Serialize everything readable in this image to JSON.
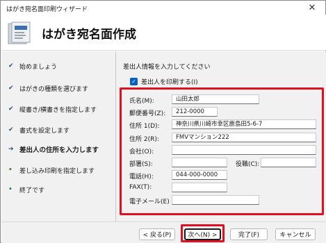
{
  "window": {
    "title": "はがき宛名面印刷ウィザード"
  },
  "header": {
    "heading": "はがき宛名面作成"
  },
  "steps": [
    {
      "mark": "✔",
      "label": "始めましょう"
    },
    {
      "mark": "✔",
      "label": "はがきの種類を選びます"
    },
    {
      "mark": "✔",
      "label": "縦書き/横書きを指定します"
    },
    {
      "mark": "✔",
      "label": "書式を設定します"
    },
    {
      "mark": "➔",
      "label": "差出人の住所を入力します"
    },
    {
      "mark": "•",
      "label": "差し込み印刷を指定します"
    },
    {
      "mark": "•",
      "label": "終了です"
    }
  ],
  "panel": {
    "instruction": "差出人情報を入力してください",
    "print_sender_label": "差出人を印刷する(I)",
    "fields": {
      "name": {
        "label": "氏名(M):",
        "value": "山田太郎"
      },
      "postal": {
        "label": "郵便番号(Z):",
        "value": "212-0000"
      },
      "address1": {
        "label": "住所 1(D):",
        "value": "神奈川県川崎市幸区鹿島田5-6-7"
      },
      "address2": {
        "label": "住所 2(R):",
        "value": "FMVマンション222"
      },
      "company": {
        "label": "会社(O):",
        "value": ""
      },
      "department": {
        "label": "部署(S):",
        "value": ""
      },
      "title": {
        "label": "役職(C):",
        "value": ""
      },
      "phone": {
        "label": "電話(H):",
        "value": "044-000-0000"
      },
      "fax": {
        "label": "FAX(T):",
        "value": ""
      },
      "email": {
        "label": "電子メール(E)",
        "value": ""
      }
    }
  },
  "footer": {
    "back": "< 戻る(P)",
    "next": "次へ(N) >",
    "finish": "完了(F)",
    "cancel": "キャンセル"
  }
}
